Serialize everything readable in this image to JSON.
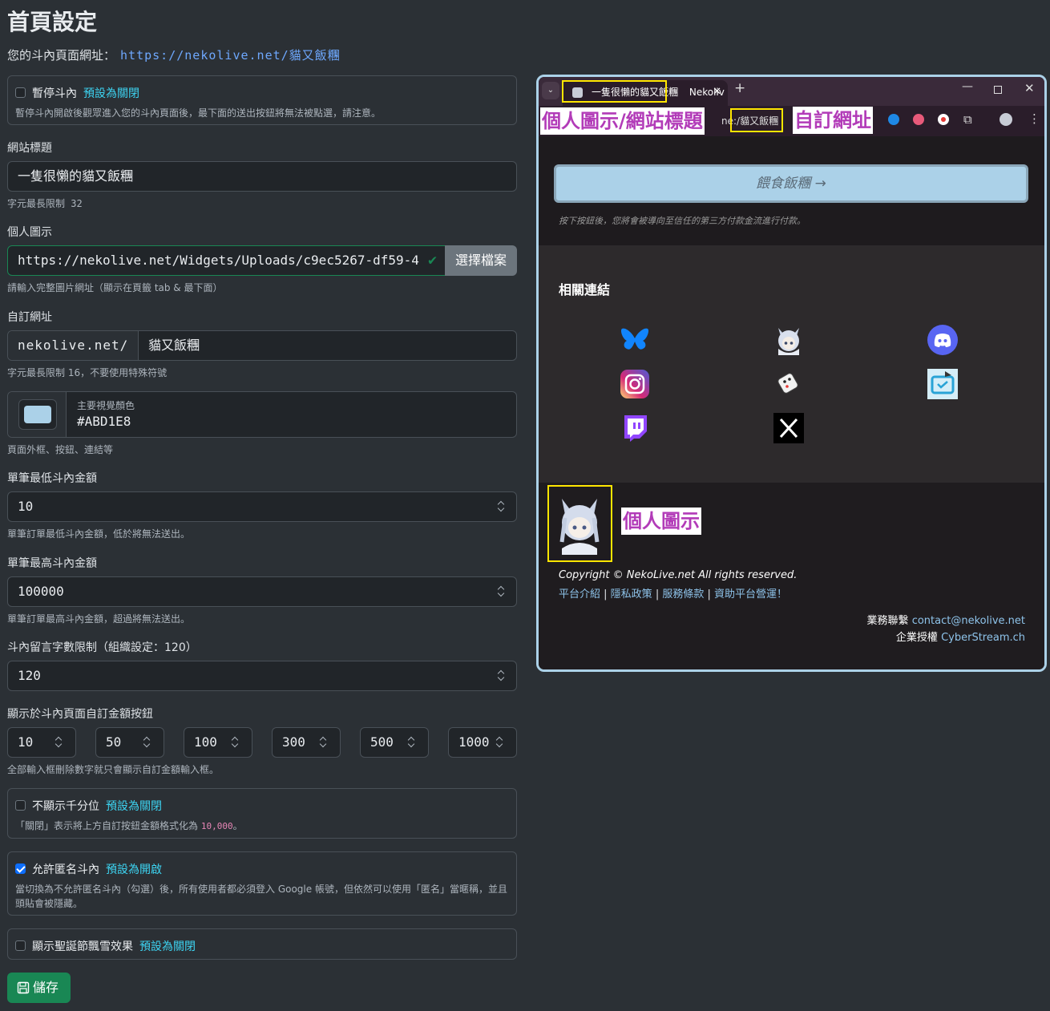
{
  "page": {
    "title": "首頁設定",
    "url_label": "您的斗內頁面網址：",
    "url_value": "https://nekolive.net/貓又飯糰"
  },
  "pause": {
    "title": "暫停斗內",
    "default": "預設為關閉",
    "desc": "暫停斗內開啟後觀眾進入您的斗內頁面後，最下面的送出按鈕將無法被點選，請注意。",
    "checked": false
  },
  "site_title": {
    "label": "網站標題",
    "value": "一隻很懶的貓又飯糰",
    "hint": "字元最長限制 32"
  },
  "avatar": {
    "label": "個人圖示",
    "value": "https://nekolive.net/Widgets/Uploads/c9ec5267-df59-4",
    "button": "選擇檔案",
    "hint": "請輸入完整圖片網址（顯示在頁籤 tab & 最下面）"
  },
  "custom_url": {
    "label": "自訂網址",
    "prefix": "nekolive.net/",
    "value": "貓又飯糰",
    "hint": "字元最長限制 16，不要使用特殊符號"
  },
  "color": {
    "label": "主要視覺顏色",
    "value": "#ABD1E8",
    "hint": "頁面外框、按鈕、連結等"
  },
  "min_amount": {
    "label": "單筆最低斗內金額",
    "value": "10",
    "hint": "單筆訂單最低斗內金額，低於將無法送出。"
  },
  "max_amount": {
    "label": "單筆最高斗內金額",
    "value": "100000",
    "hint": "單筆訂單最高斗內金額，超過將無法送出。"
  },
  "msg_limit": {
    "label": "斗內留言字數限制（組織設定：120）",
    "value": "120"
  },
  "custom_buttons": {
    "label": "顯示於斗內頁面自訂金額按鈕",
    "values": [
      "10",
      "50",
      "100",
      "300",
      "500",
      "1000"
    ],
    "hint": "全部輸入框刪除數字就只會顯示自訂金額輸入框。"
  },
  "no_thousands": {
    "title": "不顯示千分位",
    "default": "預設為關閉",
    "desc_prefix": "「關閉」表示將上方自訂按鈕金額格式化為",
    "desc_example": "10,000",
    "desc_suffix": "。",
    "checked": false
  },
  "anonymous": {
    "title": "允許匿名斗內",
    "default": "預設為開啟",
    "desc": "當切換為不允許匿名斗內（勾選）後，所有使用者都必須登入 Google 帳號，但依然可以使用「匿名」當暱稱，並且頭貼會被隱藏。",
    "checked": true
  },
  "snow": {
    "title": "顯示聖誕節飄雪效果",
    "default": "預設為關閉",
    "checked": false
  },
  "save_button": "儲存",
  "preview": {
    "tab_title": "一隻很懶的貓又飯糰",
    "tab_rest": "Nekoliv",
    "address_text": "ne:/貓又飯糰",
    "label_title": "個人圖示/網站標題",
    "label_url": "自訂網址",
    "label_avatar": "個人圖示",
    "feed_button": "餵食飯糰 →",
    "feed_note": "按下按鈕後，您將會被導向至信任的第三方付款金流進行付款。",
    "links_title": "相關連結",
    "link_icons": [
      "bluesky-icon",
      "vtuber-avatar-icon",
      "discord-icon",
      "instagram-icon",
      "dice-icon",
      "streamer-logo-icon",
      "twitch-icon",
      "x-icon"
    ],
    "copyright": "Copyright © NekoLive.net All rights reserved.",
    "footer_links": [
      "平台介紹",
      "隱私政策",
      "服務條款",
      "資助平台營運！"
    ],
    "contact_label": "業務聯繫",
    "contact_value": "contact@nekolive.net",
    "license_label": "企業授權",
    "license_value": "CyberStream.ch"
  },
  "colors": {
    "accent": "#ABD1E8",
    "link": "#3dd5f3",
    "save": "#198754",
    "highlight": "#ffe600",
    "annotation": "#b23bb8"
  }
}
